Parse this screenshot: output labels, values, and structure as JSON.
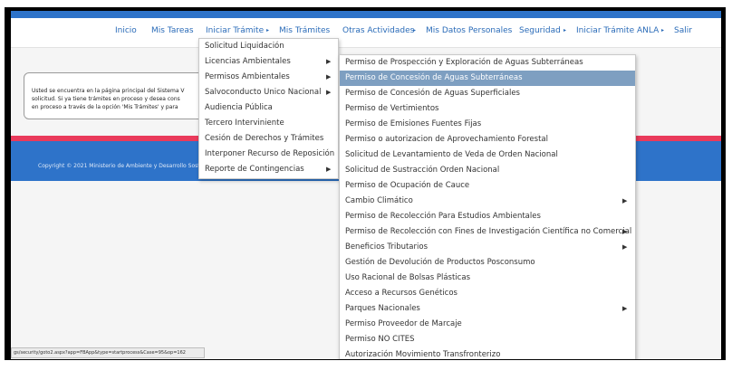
{
  "nav": {
    "items": [
      "Inicio",
      "Mis Tareas",
      "Iniciar Trámite",
      "Mis Trámites",
      "Otras Actividades",
      "Mis Datos Personales",
      "Seguridad",
      "Iniciar Trámite ANLA",
      "Salir"
    ],
    "arrow": "▸"
  },
  "notice": {
    "lines": [
      "Usted se encuentra en la página principal del Sistema V",
      "solicitud. Si ya tiene trámites en proceso y desea cons",
      "en proceso a través de la opción 'Mis Trámites' y para"
    ]
  },
  "footer": {
    "copyright": "Copyright © 2021 Ministerio de Ambiente y Desarrollo Sost"
  },
  "status_url": "gs/security/goto2.aspx?app=FBApp&type=startprocess&Case=95&op=162",
  "menu1": {
    "items": [
      {
        "label": "Solicitud Liquidación",
        "submenu": false
      },
      {
        "label": "Licencias Ambientales",
        "submenu": true
      },
      {
        "label": "Permisos Ambientales",
        "submenu": true
      },
      {
        "label": "Salvoconducto Unico Nacional",
        "submenu": true
      },
      {
        "label": "Audiencia Pública",
        "submenu": false
      },
      {
        "label": "Tercero Interviniente",
        "submenu": false
      },
      {
        "label": "Cesión de Derechos y Trámites",
        "submenu": false
      },
      {
        "label": "Interponer Recurso de Reposición",
        "submenu": false
      },
      {
        "label": "Reporte de Contingencias",
        "submenu": true
      }
    ]
  },
  "menu2": {
    "selected_index": 1,
    "items": [
      {
        "label": "Permiso de Prospección y Exploración de Aguas Subterráneas",
        "submenu": false
      },
      {
        "label": "Permiso de Concesión de Aguas Subterráneas",
        "submenu": false
      },
      {
        "label": "Permiso de Concesión de Aguas Superficiales",
        "submenu": false
      },
      {
        "label": "Permiso de Vertimientos",
        "submenu": false
      },
      {
        "label": "Permiso de Emisiones Fuentes Fijas",
        "submenu": false
      },
      {
        "label": "Permiso o autorizacion de Aprovechamiento Forestal",
        "submenu": false
      },
      {
        "label": "Solicitud de Levantamiento de Veda de Orden Nacional",
        "submenu": false
      },
      {
        "label": "Solicitud de Sustracción Orden Nacional",
        "submenu": false
      },
      {
        "label": "Permiso de Ocupación de Cauce",
        "submenu": false
      },
      {
        "label": "Cambio Climático",
        "submenu": true
      },
      {
        "label": "Permiso de Recolección Para Estudios Ambientales",
        "submenu": false
      },
      {
        "label": "Permiso de Recolección con Fines de Investigación Científica no Comercial",
        "submenu": true
      },
      {
        "label": "Beneficios Tributarios",
        "submenu": true
      },
      {
        "label": "Gestión de Devolución de Productos Posconsumo",
        "submenu": false
      },
      {
        "label": "Uso Racional de Bolsas Plásticas",
        "submenu": false
      },
      {
        "label": "Acceso a Recursos Genéticos",
        "submenu": false
      },
      {
        "label": "Parques Nacionales",
        "submenu": true
      },
      {
        "label": "Permiso Proveedor de Marcaje",
        "submenu": false
      },
      {
        "label": "Permiso NO CITES",
        "submenu": false
      },
      {
        "label": "Autorización Movimiento Transfronterizo",
        "submenu": false
      }
    ]
  }
}
